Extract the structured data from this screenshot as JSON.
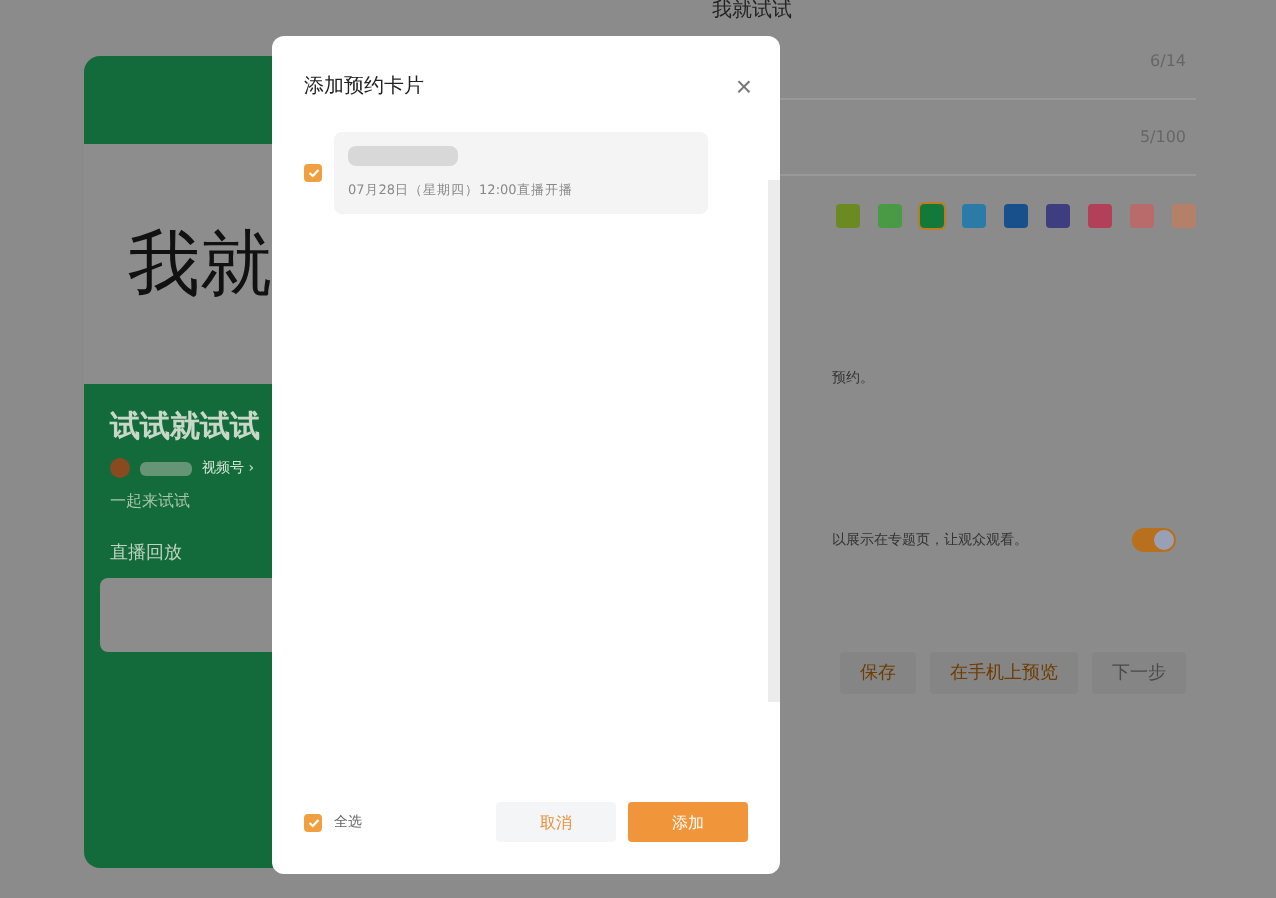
{
  "background": {
    "page_title": "我就试试",
    "preview": {
      "cover_text": "我就",
      "title": "试试就试试",
      "account_label": "视频号 ›",
      "subtitle": "一起来试试",
      "section": "直播回放"
    },
    "form": {
      "counters": [
        "6/14",
        "5/100"
      ],
      "swatches": [
        {
          "color": "#6b8a22",
          "selected": false
        },
        {
          "color": "#4a9a45",
          "selected": false
        },
        {
          "color": "#117a3a",
          "selected": true
        },
        {
          "color": "#2b7aa8",
          "selected": false
        },
        {
          "color": "#17508a",
          "selected": false
        },
        {
          "color": "#3e3d80",
          "selected": false
        },
        {
          "color": "#b24058",
          "selected": false
        },
        {
          "color": "#b96a6a",
          "selected": false
        },
        {
          "color": "#b58068",
          "selected": false
        }
      ],
      "note_1": "预约。",
      "note_2": "以展示在专题页，让观众观看。",
      "toggle_on": true,
      "buttons": [
        {
          "label": "保存",
          "kind": "secondary"
        },
        {
          "label": "在手机上预览",
          "kind": "secondary"
        },
        {
          "label": "下一步",
          "kind": "disabled"
        }
      ]
    }
  },
  "dialog": {
    "title": "添加预约卡片",
    "close": "×",
    "items": [
      {
        "checked": true,
        "time": "07月28日（星期四）12:00直播开播"
      }
    ],
    "select_all": {
      "label": "全选",
      "checked": true
    },
    "buttons": [
      {
        "label": "取消",
        "kind": "cancel"
      },
      {
        "label": "添加",
        "kind": "primary"
      }
    ]
  }
}
